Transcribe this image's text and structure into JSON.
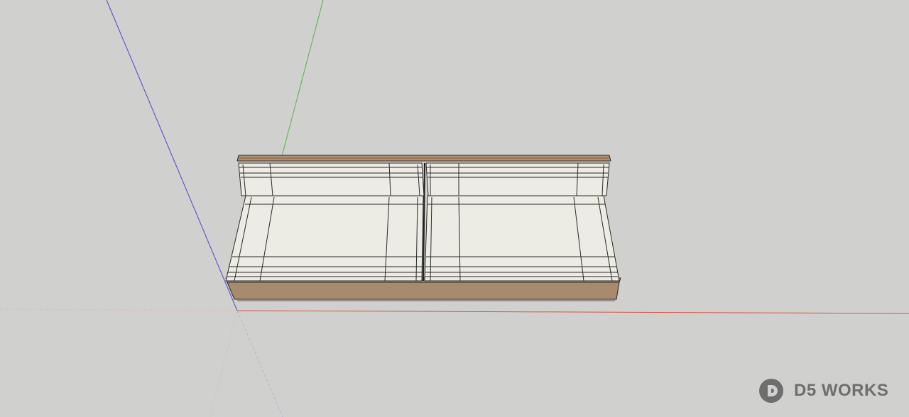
{
  "watermark": {
    "text": "D5 WORKS",
    "icon": "d5-logo-icon"
  },
  "colors": {
    "background": "#d0d0ce",
    "wood": "#a88a6c",
    "cushion": "#ecebe4",
    "axis_red": "#d9534f",
    "axis_green": "#58b14b",
    "axis_blue": "#4a4ac8",
    "logo": "#6e6e6e"
  }
}
